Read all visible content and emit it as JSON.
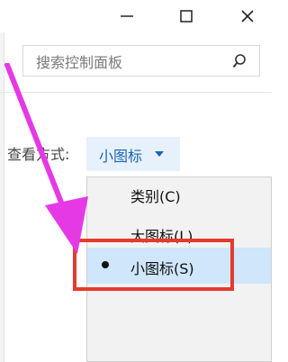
{
  "window": {
    "minimize_icon": "minimize-icon",
    "maximize_icon": "maximize-icon",
    "close_icon": "close-icon"
  },
  "search": {
    "placeholder": "搜索控制面板",
    "icon": "search-icon"
  },
  "view": {
    "label": "查看方式:",
    "current": "小图标"
  },
  "menu": {
    "items": [
      {
        "label": "类别(C)",
        "selected": false
      },
      {
        "label": "大图标(L)",
        "selected": false
      },
      {
        "label": "小图标(S)",
        "selected": true
      }
    ]
  },
  "annotation": {
    "arrow_color": "#e639e6",
    "box_color": "#e53a2e"
  },
  "colors": {
    "accent": "#1a66b8",
    "selected_bg": "#cfe6fb"
  }
}
